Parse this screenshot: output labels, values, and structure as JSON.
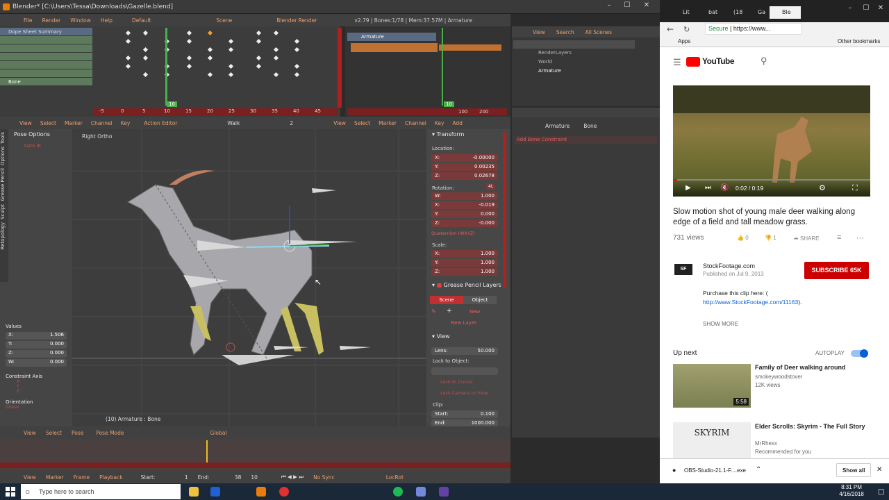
{
  "blender": {
    "window_title": "Blender* [C:\\Users\\Tessa\\Downloads\\Gazelle.blend]",
    "menu": [
      "File",
      "Render",
      "Window",
      "Help"
    ],
    "layout": "Default",
    "scene": "Scene",
    "engine": "Blender Render",
    "stats": "v2.79 | Bones:1/78 | Mem:37.57M | Armature",
    "dopesheet": {
      "channels": [
        "Dope Sheet Summary",
        "",
        "",
        "",
        "",
        "",
        "Bone"
      ],
      "ruler": [
        "-5",
        "0",
        "5",
        "10",
        "15",
        "20",
        "25",
        "30",
        "35",
        "40",
        "45"
      ],
      "current_frame": "10"
    },
    "graph": {
      "channel": "Armature",
      "ruler": [
        "100",
        "200"
      ],
      "current": "10"
    },
    "outliner": {
      "menu": [
        "View",
        "Search",
        "All Scenes"
      ],
      "items": [
        "RenderLayers",
        "World",
        "Armature"
      ]
    },
    "editor_header": {
      "menu": [
        "View",
        "Select",
        "Marker",
        "Channel",
        "Key"
      ],
      "mode": "Action Editor",
      "action": "Walk",
      "users": "2",
      "menu2": [
        "View",
        "Select",
        "Marker",
        "Channel",
        "Key",
        "Add"
      ]
    },
    "properties": {
      "path": [
        "Armature",
        "Bone"
      ],
      "add_constraint": "Add Bone Constraint"
    },
    "toolshelf": {
      "tabs": [
        "Tools",
        "Options",
        "Grease Pencil",
        "Sculpt",
        "Retopology"
      ],
      "section": "Pose Options",
      "auto_ik": "Auto IK"
    },
    "viewport": {
      "view_label": "Right Ortho",
      "status": "(10) Armature : Bone"
    },
    "operator": {
      "title": "Values",
      "x": "1.506",
      "y": "0.000",
      "z": "0.000",
      "w": "0.000",
      "constraint_title": "Constraint Axis",
      "axes": [
        "X",
        "Y",
        "Z"
      ],
      "orientation": "Orientation",
      "orientation_val": "Global"
    },
    "npanel": {
      "transform": "Transform",
      "location": "Location:",
      "loc": {
        "x": "-0.00000",
        "y": "0.00235",
        "z": "0.02678"
      },
      "rotation": "Rotation:",
      "rot_lock": "4L",
      "rot": {
        "w": "1.000",
        "x": "-0.019",
        "y": "0.000",
        "z": "-0.000"
      },
      "rot_mode": "Quaternion (WXYZ)",
      "scale": "Scale:",
      "scl": {
        "x": "1.000",
        "y": "1.000",
        "z": "1.000"
      },
      "gp_layers": "Grease Pencil Layers",
      "gp_scene": "Scene",
      "gp_object": "Object",
      "gp_new": "New",
      "gp_new_layer": "New Layer",
      "view": "View",
      "lens_label": "Lens:",
      "lens": "50.000",
      "lock_object": "Lock to Object:",
      "lock_cursor": "Lock to Cursor",
      "lock_camera": "Lock Camera to View",
      "clip": "Clip:",
      "clip_start_label": "Start:",
      "clip_start": "0.100",
      "clip_end_label": "End:",
      "clip_end": "1000.000"
    },
    "view_header": {
      "menu": [
        "View",
        "Select",
        "Pose"
      ],
      "mode": "Pose Mode",
      "orientation": "Global"
    },
    "timeline_footer": {
      "menu": [
        "View",
        "Marker",
        "Frame",
        "Playback"
      ],
      "start_label": "Start:",
      "start": "1",
      "end_label": "End:",
      "end": "38",
      "current": "10",
      "sync": "No Sync",
      "keying": "LocRot"
    }
  },
  "chrome": {
    "tabs": [
      "Lit",
      "bat",
      "(18",
      "Ga",
      "Ble"
    ],
    "address": "https://www...",
    "secure": "Secure",
    "bookmarks": [
      "Apps"
    ],
    "other_bookmarks": "Other bookmarks",
    "youtube": {
      "brand": "YouTube",
      "time": "0:02 / 0:19",
      "title": "Slow motion shot of young male deer walking along edge of a field and tall meadow grass.",
      "views": "731 views",
      "likes": "0",
      "dislikes": "1",
      "share": "SHARE",
      "channel": "StockFootage.com",
      "published": "Published on Jul 9, 2013",
      "subscribe": "SUBSCRIBE 65K",
      "desc": "Purchase this clip here: (",
      "link": "http://www.StockFootage.com/11163",
      "link_tail": ").",
      "show_more": "SHOW MORE",
      "up_next": "Up next",
      "autoplay": "AUTOPLAY",
      "rec1": {
        "title": "Family of Deer walking around",
        "channel": "smokeywoodstover",
        "views": "12K views",
        "duration": "5:58"
      },
      "rec2": {
        "title": "Elder Scrolls: Skyrim - The Full Story",
        "channel": "MrRhexx",
        "views": "Recommended for you",
        "thumb": "SKYRIM"
      }
    },
    "download": {
      "file": "OBS-Studio-21.1-F....exe",
      "show_all": "Show all"
    }
  },
  "taskbar": {
    "search": "Type here to search",
    "time": "8:31 PM",
    "date": "4/16/2018"
  }
}
